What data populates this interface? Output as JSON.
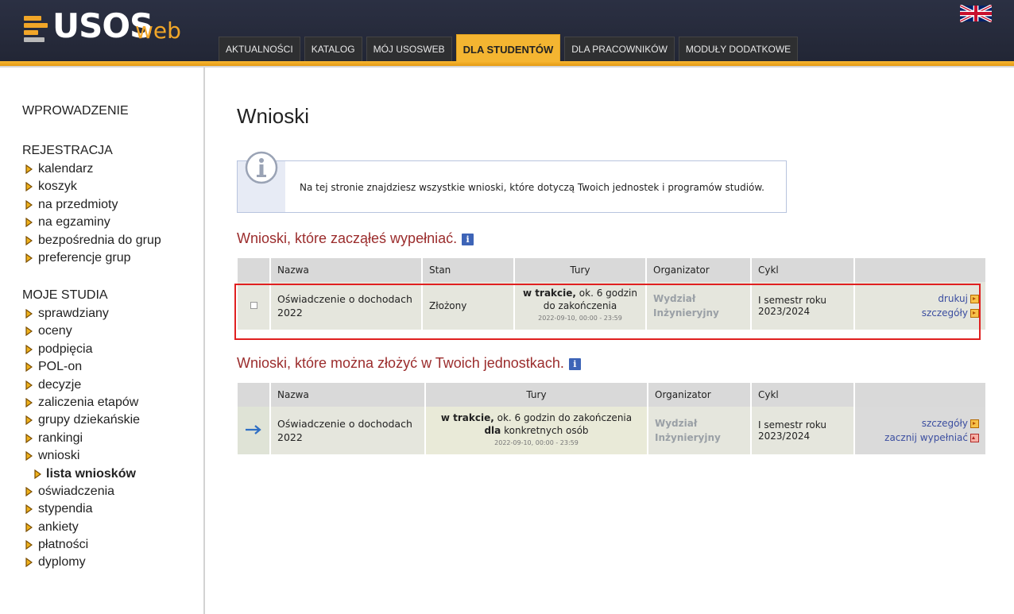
{
  "header": {
    "logo_text": "USOS",
    "logo_suffix": "web",
    "language_flag": "uk-flag-icon",
    "tabs": [
      "AKTUALNOŚCI",
      "KATALOG",
      "MÓJ USOSWEB",
      "DLA STUDENTÓW",
      "DLA PRACOWNIKÓW",
      "MODUŁY DODATKOWE"
    ],
    "active_tab": "DLA STUDENTÓW"
  },
  "sidebar": {
    "intro": "WPROWADZENIE",
    "registration_heading": "REJESTRACJA",
    "registration_items": [
      "kalendarz",
      "koszyk",
      "na przedmioty",
      "na egzaminy",
      "bezpośrednia do grup",
      "preferencje grup"
    ],
    "studies_heading": "MOJE STUDIA",
    "studies_items": [
      "sprawdziany",
      "oceny",
      "podpięcia",
      "POL-on",
      "decyzje",
      "zaliczenia etapów",
      "grupy dziekańskie",
      "rankingi",
      "wnioski"
    ],
    "studies_subitem": "lista wniosków",
    "studies_items_after": [
      "oświadczenia",
      "stypendia",
      "ankiety",
      "płatności",
      "dyplomy"
    ]
  },
  "main": {
    "title": "Wnioski",
    "info_text": "Na tej stronie znajdziesz wszystkie wnioski, które dotyczą Twoich jednostek i programów studiów.",
    "section1": {
      "title": "Wnioski, które zacząłeś wypełniać.",
      "headers": [
        "Nazwa",
        "Stan",
        "Tury",
        "Organizator",
        "Cykl"
      ],
      "row": {
        "name": "Oświadczenie o dochodach 2022",
        "status": "Złożony",
        "tury_bold": "w trakcie,",
        "tury_rest": "ok. 6 godzin do zakończenia",
        "tury_date": "2022-09-10, 00:00 - 23:59",
        "organizer": "Wydział Inżynieryjny",
        "cycle": "I semestr roku 2023/2024",
        "action1": "drukuj",
        "action2": "szczegóły"
      }
    },
    "section2": {
      "title": "Wnioski, które można złożyć w Twoich jednostkach.",
      "headers": [
        "Nazwa",
        "Tury",
        "Organizator",
        "Cykl"
      ],
      "row": {
        "name": "Oświadczenie o dochodach 2022",
        "tury_bold": "w trakcie,",
        "tury_rest": "ok. 6 godzin do zakończenia",
        "tury_bold2": "dla",
        "tury_rest2": "konkretnych osób",
        "tury_date": "2022-09-10, 00:00 - 23:59",
        "organizer": "Wydział Inżynieryjny",
        "cycle": "I semestr roku 2023/2024",
        "action1": "szczegóły",
        "action2": "zacznij wypełniać"
      }
    }
  },
  "colors": {
    "accent": "#f4b531",
    "section_title": "#9b2c2c",
    "link": "#3b4ea0",
    "highlight": "#e02020"
  }
}
